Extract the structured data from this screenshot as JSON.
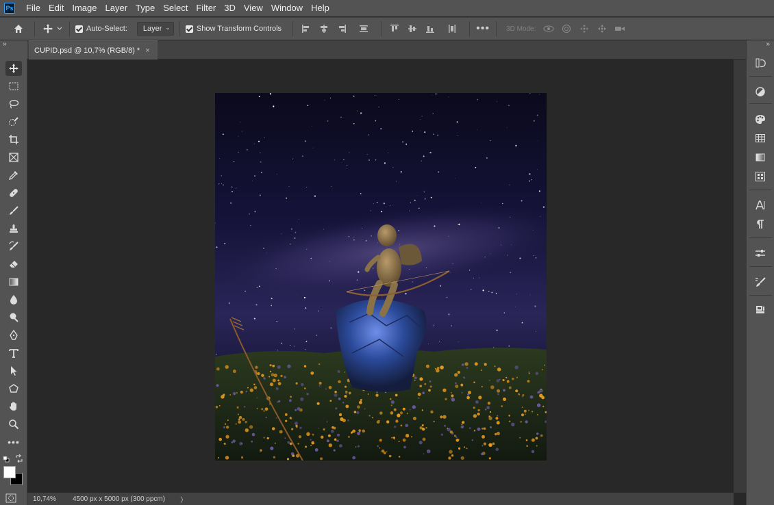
{
  "app": {
    "logo_text": "Ps"
  },
  "menu": [
    "File",
    "Edit",
    "Image",
    "Layer",
    "Type",
    "Select",
    "Filter",
    "3D",
    "View",
    "Window",
    "Help"
  ],
  "options": {
    "auto_select_label": "Auto-Select:",
    "auto_select_checked": true,
    "auto_select_target": "Layer",
    "show_transform_label": "Show Transform Controls",
    "show_transform_checked": true,
    "mode_3d_label": "3D Mode:"
  },
  "panel_collapse_glyph": "»",
  "document_tab": {
    "title": "CUPID.psd @ 10,7% (RGB/8) *",
    "close": "×"
  },
  "status": {
    "zoom": "10,74%",
    "doc_info": "4500 px x 5000 px (300 ppcm)",
    "arrow": "〉"
  },
  "tools": [
    "move-tool-icon",
    "rectangular-marquee-icon",
    "lasso-icon",
    "quick-selection-icon",
    "crop-icon",
    "frame-icon",
    "eyedropper-icon",
    "healing-brush-icon",
    "brush-icon",
    "clone-stamp-icon",
    "history-brush-icon",
    "eraser-icon",
    "gradient-icon",
    "blur-icon",
    "dodge-icon",
    "pen-icon",
    "type-icon",
    "path-selection-icon",
    "shape-icon",
    "hand-icon",
    "zoom-icon",
    "edit-toolbar-icon"
  ],
  "colors": {
    "foreground": "#ffffff",
    "background": "#000000",
    "ui_dark": "#535353",
    "canvas_bg": "#282828"
  },
  "right_panels": [
    "history-icon",
    "adjustments-icon",
    "color-swatches-icon",
    "swatches-grid-icon",
    "gradients-icon",
    "patterns-icon",
    "character-icon",
    "paragraph-icon",
    "properties-icon",
    "brush-settings-icon",
    "libraries-icon"
  ]
}
